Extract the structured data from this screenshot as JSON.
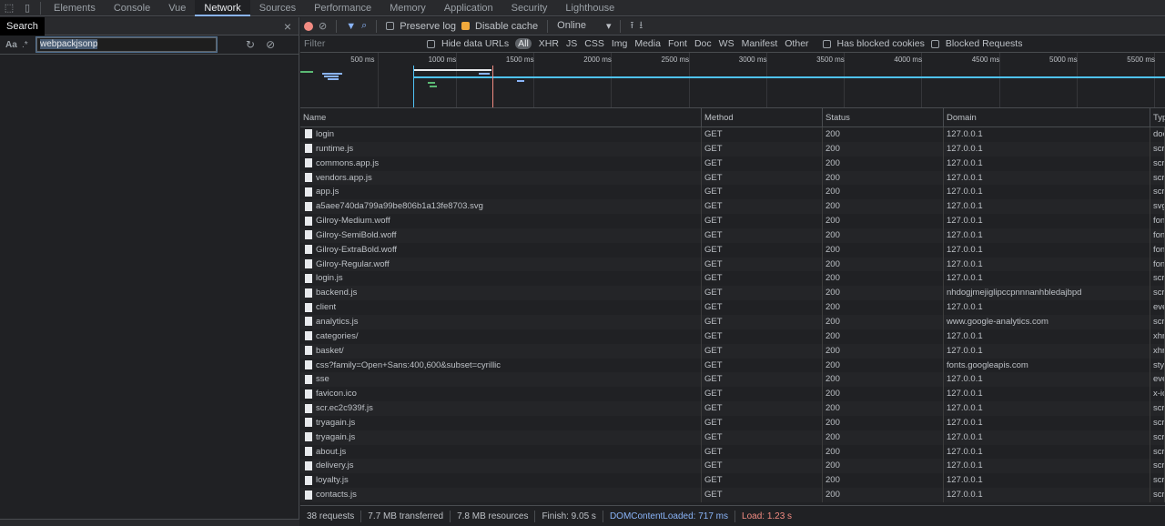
{
  "tabs": [
    "Elements",
    "Console",
    "Vue",
    "Network",
    "Sources",
    "Performance",
    "Memory",
    "Application",
    "Security",
    "Lighthouse"
  ],
  "active_tab": "Network",
  "search": {
    "tab_label": "Search",
    "close": "×",
    "case_label": "Aa",
    "regex_label": ".*",
    "query": "webpackjsonp"
  },
  "toolbar": {
    "preserve_log": "Preserve log",
    "disable_cache": "Disable cache",
    "throttle": "Online",
    "throttle_arrow": "▾"
  },
  "filter": {
    "placeholder": "Filter",
    "hide_data_urls": "Hide data URLs",
    "types": [
      "All",
      "XHR",
      "JS",
      "CSS",
      "Img",
      "Media",
      "Font",
      "Doc",
      "WS",
      "Manifest",
      "Other"
    ],
    "blocked_cookies": "Has blocked cookies",
    "blocked_requests": "Blocked Requests"
  },
  "timeline": {
    "ticks": [
      "500 ms",
      "1000 ms",
      "1500 ms",
      "2000 ms",
      "2500 ms",
      "3000 ms",
      "3500 ms",
      "4000 ms",
      "4500 ms",
      "5000 ms",
      "5500 ms"
    ]
  },
  "columns": [
    "Name",
    "Method",
    "Status",
    "Domain",
    "Typ"
  ],
  "rows": [
    [
      "login",
      "GET",
      "200",
      "127.0.0.1",
      "doc"
    ],
    [
      "runtime.js",
      "GET",
      "200",
      "127.0.0.1",
      "scr"
    ],
    [
      "commons.app.js",
      "GET",
      "200",
      "127.0.0.1",
      "scr"
    ],
    [
      "vendors.app.js",
      "GET",
      "200",
      "127.0.0.1",
      "scr"
    ],
    [
      "app.js",
      "GET",
      "200",
      "127.0.0.1",
      "scr"
    ],
    [
      "a5aee740da799a99be806b1a13fe8703.svg",
      "GET",
      "200",
      "127.0.0.1",
      "svg"
    ],
    [
      "Gilroy-Medium.woff",
      "GET",
      "200",
      "127.0.0.1",
      "fon"
    ],
    [
      "Gilroy-SemiBold.woff",
      "GET",
      "200",
      "127.0.0.1",
      "fon"
    ],
    [
      "Gilroy-ExtraBold.woff",
      "GET",
      "200",
      "127.0.0.1",
      "fon"
    ],
    [
      "Gilroy-Regular.woff",
      "GET",
      "200",
      "127.0.0.1",
      "fon"
    ],
    [
      "login.js",
      "GET",
      "200",
      "127.0.0.1",
      "scr"
    ],
    [
      "backend.js",
      "GET",
      "200",
      "nhdogjmejiglipccpnnnanhbledajbpd",
      "scr"
    ],
    [
      "client",
      "GET",
      "200",
      "127.0.0.1",
      "eve"
    ],
    [
      "analytics.js",
      "GET",
      "200",
      "www.google-analytics.com",
      "scr"
    ],
    [
      "categories/",
      "GET",
      "200",
      "127.0.0.1",
      "xhr"
    ],
    [
      "basket/",
      "GET",
      "200",
      "127.0.0.1",
      "xhr"
    ],
    [
      "css?family=Open+Sans:400,600&subset=cyrillic",
      "GET",
      "200",
      "fonts.googleapis.com",
      "styl"
    ],
    [
      "sse",
      "GET",
      "200",
      "127.0.0.1",
      "eve"
    ],
    [
      "favicon.ico",
      "GET",
      "200",
      "127.0.0.1",
      "x-ic"
    ],
    [
      "scr.ec2c939f.js",
      "GET",
      "200",
      "127.0.0.1",
      "scr"
    ],
    [
      "tryagain.js",
      "GET",
      "200",
      "127.0.0.1",
      "scr"
    ],
    [
      "tryagain.js",
      "GET",
      "200",
      "127.0.0.1",
      "scr"
    ],
    [
      "about.js",
      "GET",
      "200",
      "127.0.0.1",
      "scr"
    ],
    [
      "delivery.js",
      "GET",
      "200",
      "127.0.0.1",
      "scr"
    ],
    [
      "loyalty.js",
      "GET",
      "200",
      "127.0.0.1",
      "scr"
    ],
    [
      "contacts.js",
      "GET",
      "200",
      "127.0.0.1",
      "scr"
    ]
  ],
  "status": {
    "requests": "38 requests",
    "transferred": "7.7 MB transferred",
    "resources": "7.8 MB resources",
    "finish": "Finish: 9.05 s",
    "dcl": "DOMContentLoaded: 717 ms",
    "load": "Load: 1.23 s"
  }
}
